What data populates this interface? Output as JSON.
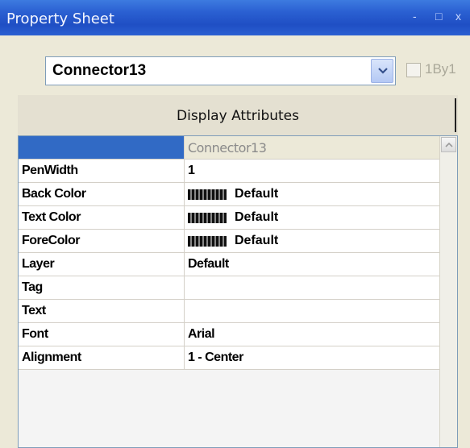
{
  "window": {
    "title": "Property Sheet",
    "controls": "- □ x"
  },
  "selector": {
    "selected": "Connector13"
  },
  "checkbox": {
    "label": "1By1",
    "checked": false
  },
  "tab": {
    "label": "Display Attributes"
  },
  "grid": {
    "header": {
      "name": "",
      "value": "Connector13"
    },
    "rows": [
      {
        "name": "PenWidth",
        "value": "1"
      },
      {
        "name": "Back Color",
        "value": "Default",
        "swatch": true
      },
      {
        "name": "Text Color",
        "value": "Default",
        "swatch": true
      },
      {
        "name": "ForeColor",
        "value": "Default",
        "swatch": true
      },
      {
        "name": "Layer",
        "value": "Default"
      },
      {
        "name": "Tag",
        "value": ""
      },
      {
        "name": "Text",
        "value": ""
      },
      {
        "name": "Font",
        "value": "Arial"
      },
      {
        "name": "Alignment",
        "value": "1 - Center"
      }
    ]
  },
  "icons": {
    "dropdown": "chevron-down-icon",
    "scroll_up": "chevron-up-icon"
  },
  "colors": {
    "titlebar": "#2a5fd1",
    "selection": "#316ac5",
    "panel": "#ece9d8"
  }
}
